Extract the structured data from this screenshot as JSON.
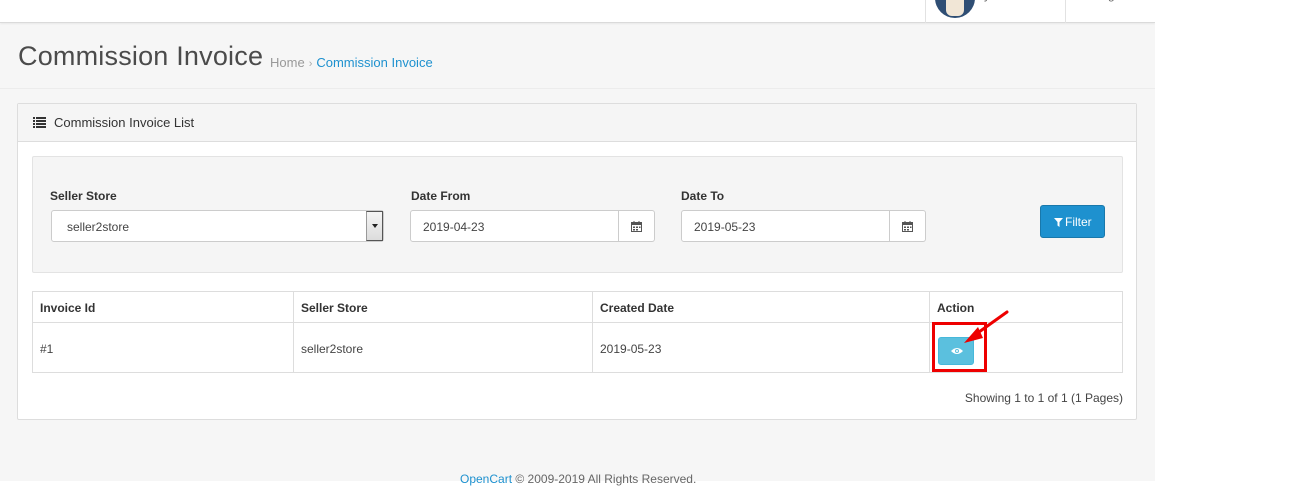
{
  "header": {
    "user_name": "y",
    "logout_label": "g"
  },
  "page": {
    "title": "Commission Invoice",
    "breadcrumb": {
      "home": "Home",
      "separator": "›",
      "current": "Commission Invoice"
    }
  },
  "panel": {
    "icon": "list-icon",
    "title": "Commission Invoice List"
  },
  "filter": {
    "seller_store_label": "Seller Store",
    "seller_store_value": "seller2store",
    "date_from_label": "Date From",
    "date_from_value": "2019-04-23",
    "date_to_label": "Date To",
    "date_to_value": "2019-05-23",
    "filter_button_label": "Filter",
    "filter_icon": "funnel-icon",
    "calendar_icon": "calendar-icon"
  },
  "table": {
    "headers": [
      "Invoice Id",
      "Seller Store",
      "Created Date",
      "Action"
    ],
    "rows": [
      {
        "invoice_id": "#1",
        "seller_store": "seller2store",
        "created_date": "2019-05-23",
        "action_icon": "eye-icon"
      }
    ]
  },
  "pagination": {
    "info": "Showing 1 to 1 of 1 (1 Pages)"
  },
  "footer": {
    "link": "OpenCart",
    "text": " © 2009-2019 All Rights Reserved."
  },
  "colors": {
    "primary": "#1e91cf",
    "info": "#5bc0de",
    "highlight": "#ee0000"
  }
}
